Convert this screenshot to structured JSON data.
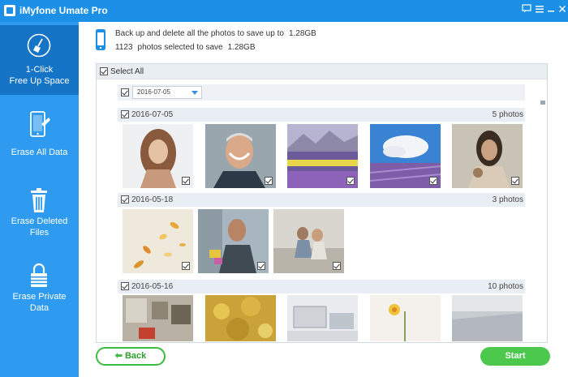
{
  "app": {
    "title": "iMyfone Umate Pro"
  },
  "window_controls": [
    "chat-icon",
    "menu-icon",
    "minimize-icon",
    "close-icon"
  ],
  "sidebar": {
    "items": [
      {
        "label": "1-Click\nFree Up Space",
        "icon": "broom-icon",
        "active": true
      },
      {
        "label": "Erase All Data",
        "icon": "phone-erase-icon",
        "active": false
      },
      {
        "label": "Erase Deleted\nFiles",
        "icon": "trash-icon",
        "active": false
      },
      {
        "label": "Erase Private\nData",
        "icon": "lock-icon",
        "active": false
      }
    ]
  },
  "header": {
    "line1_text": "Back up and delete all the photos to save up to",
    "line1_size": "1.28GB",
    "line2_count": "1123",
    "line2_text": "photos selected to save",
    "line2_size": "1.28GB"
  },
  "select_all": {
    "label": "Select All",
    "checked": true
  },
  "date_filter": {
    "value": "2016-07-05"
  },
  "groups": [
    {
      "date": "2016-07-05",
      "count": "5 photos",
      "photos": 5
    },
    {
      "date": "2016-05-18",
      "count": "3 photos",
      "photos": 3
    },
    {
      "date": "2016-05-16",
      "count": "10 photos",
      "photos": 5
    }
  ],
  "buttons": {
    "back": "Back",
    "start": "Start"
  },
  "colors": {
    "titlebar": "#1c8fe6",
    "sidebar": "#2e9bf0",
    "sidebar_active": "#1674c7",
    "start": "#4cc94c"
  }
}
